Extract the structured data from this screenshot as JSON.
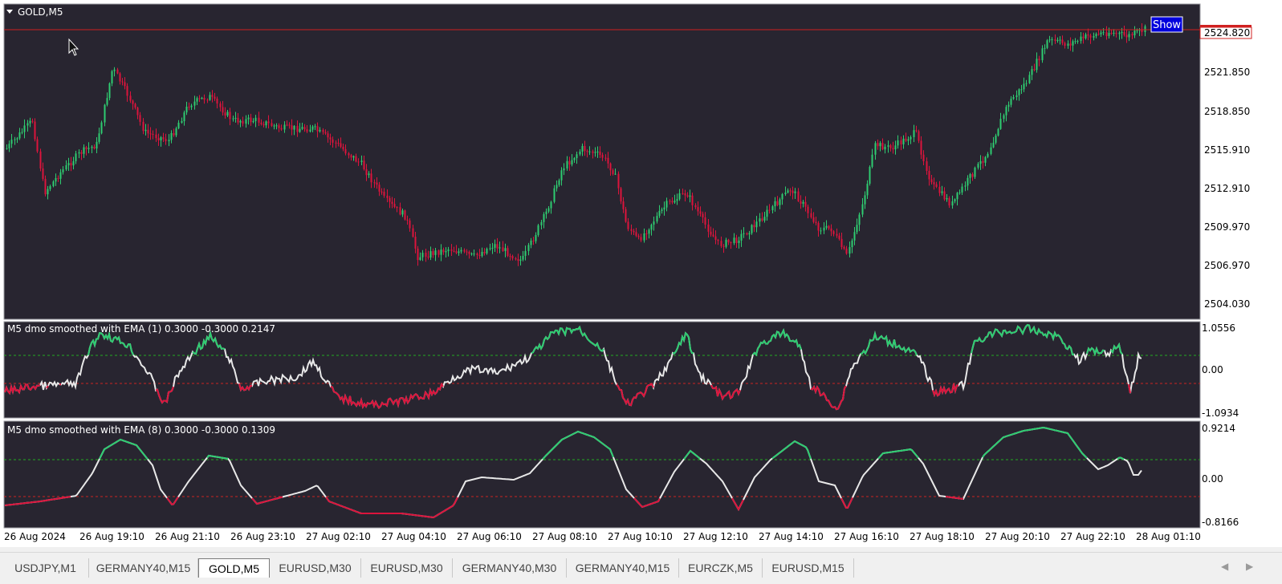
{
  "main_chart": {
    "symbol_label": "GOLD,M5",
    "current_price": "2524.820",
    "show_button": "Show",
    "price_ticks": [
      "2521.850",
      "2518.850",
      "2515.910",
      "2512.910",
      "2509.970",
      "2506.970",
      "2504.030"
    ],
    "bull_color": "#2ecc71",
    "bear_color": "#dc143c",
    "bg_color": "#282530"
  },
  "indicator1": {
    "label": "M5 dmo smoothed with EMA (1) 0.3000 -0.3000 0.2147",
    "ticks": [
      "1.0556",
      "0.00",
      "-1.0934"
    ]
  },
  "indicator2": {
    "label": "M5 dmo smoothed with EMA (8) 0.3000 -0.3000 0.1309",
    "ticks": [
      "0.9214",
      "0.00",
      "-0.8166"
    ]
  },
  "time_axis": [
    "26 Aug 2024",
    "26 Aug 19:10",
    "26 Aug 21:10",
    "26 Aug 23:10",
    "27 Aug 02:10",
    "27 Aug 04:10",
    "27 Aug 06:10",
    "27 Aug 08:10",
    "27 Aug 10:10",
    "27 Aug 12:10",
    "27 Aug 14:10",
    "27 Aug 16:10",
    "27 Aug 18:10",
    "27 Aug 20:10",
    "27 Aug 22:10",
    "28 Aug 01:10"
  ],
  "tabs": [
    {
      "label": "USDJPY,M1",
      "active": false
    },
    {
      "label": "GERMANY40,M15",
      "active": false
    },
    {
      "label": "GOLD,M5",
      "active": true
    },
    {
      "label": "EURUSD,M30",
      "active": false
    },
    {
      "label": "EURUSD,M30",
      "active": false
    },
    {
      "label": "GERMANY40,M30",
      "active": false
    },
    {
      "label": "GERMANY40,M15",
      "active": false
    },
    {
      "label": "EURCZK,M5",
      "active": false
    },
    {
      "label": "EURUSD,M15",
      "active": false
    }
  ],
  "tab_nav": {
    "prev_icon": "◀",
    "next_icon": "▶"
  }
}
